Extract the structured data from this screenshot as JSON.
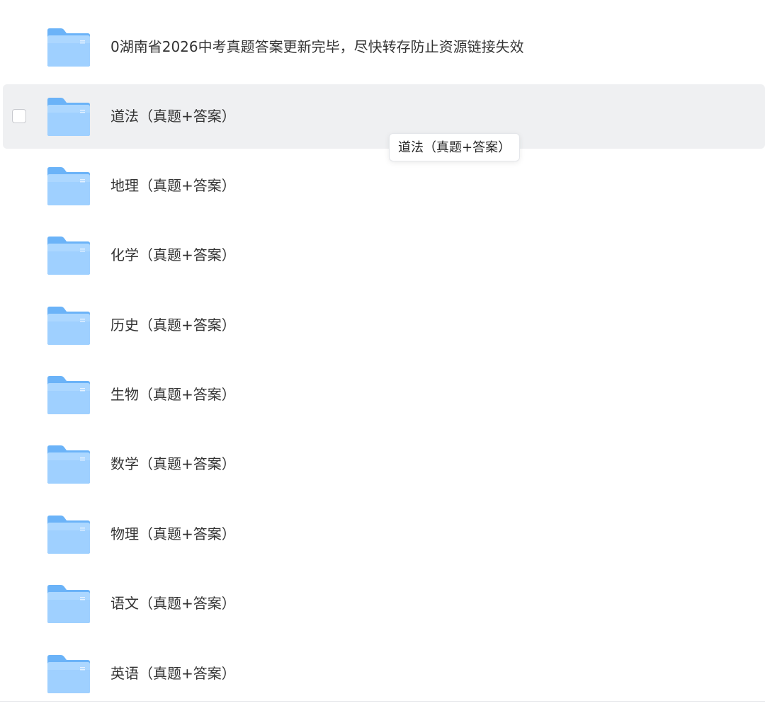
{
  "colors": {
    "folder_light": "#9fd0ff",
    "folder_dark": "#6bb3f8",
    "hover_bg": "#eff0f2"
  },
  "files": [
    {
      "name": "0湖南省2026中考真题答案更新完毕，尽快转存防止资源链接失效",
      "icon": "folder-icon",
      "hovered": false
    },
    {
      "name": "道法（真题+答案）",
      "icon": "folder-icon",
      "hovered": true
    },
    {
      "name": "地理（真题+答案）",
      "icon": "folder-icon",
      "hovered": false
    },
    {
      "name": "化学（真题+答案）",
      "icon": "folder-icon",
      "hovered": false
    },
    {
      "name": "历史（真题+答案）",
      "icon": "folder-icon",
      "hovered": false
    },
    {
      "name": "生物（真题+答案）",
      "icon": "folder-icon",
      "hovered": false
    },
    {
      "name": "数学（真题+答案）",
      "icon": "folder-icon",
      "hovered": false
    },
    {
      "name": "物理（真题+答案）",
      "icon": "folder-icon",
      "hovered": false
    },
    {
      "name": "语文（真题+答案）",
      "icon": "folder-icon",
      "hovered": false
    },
    {
      "name": "英语（真题+答案）",
      "icon": "folder-icon",
      "hovered": false
    }
  ],
  "tooltip": {
    "text": "道法（真题+答案）"
  }
}
